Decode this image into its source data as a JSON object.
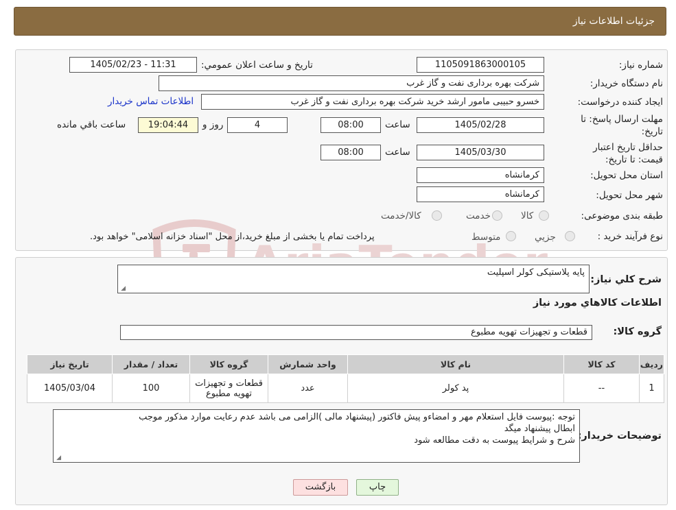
{
  "header": {
    "title": "جزئیات اطلاعات نیاز"
  },
  "colors": {
    "header_bg": "#8a6c41",
    "link": "#1a33c9",
    "panel_bg": "#f7f7f7",
    "watermark": "#e8cccc",
    "yellow_box": "#fdfbd5"
  },
  "watermark": {
    "text": "AriaTender.neT"
  },
  "form": {
    "need_number_label": "شماره نیاز:",
    "need_number": "1105091863000105",
    "announce_label": "تاریخ و ساعت اعلان عمومي:",
    "announce_value": "1405/02/23 - 11:31",
    "buyer_label": "نام دستگاه خريدار:",
    "buyer_value": "شرکت بهره برداری نفت و گاز غرب",
    "creator_label": "ايجاد کننده درخواست:",
    "creator_value": "خسرو حبیبی مامور ارشد خرید شرکت بهره برداری نفت و گاز غرب",
    "contact_link": "اطلاعات تماس خريدار",
    "deadline_label": "مهلت ارسال پاسخ: تا تاریخ:",
    "deadline_date": "1405/02/28",
    "time_label": "ساعت",
    "deadline_time": "08:00",
    "days_value": "4",
    "days_label": "روز و",
    "remaining_time": "19:04:44",
    "remaining_label": "ساعت باقي مانده",
    "validity_label": "حداقل تاريخ اعتبار قيمت: تا تاریخ:",
    "validity_date": "1405/03/30",
    "validity_time": "08:00",
    "province_label": "استان محل تحویل:",
    "province_value": "کرمانشاه",
    "city_label": "شهر محل تحویل:",
    "city_value": "کرمانشاه",
    "category_label": "طبقه بندی موضوعی:",
    "category_options": [
      "کالا",
      "خدمت",
      "کالا/خدمت"
    ],
    "process_label": "نوع فرآيند خريد :",
    "process_options": [
      "جزيي",
      "متوسط"
    ],
    "process_note": "پرداخت تمام یا بخشی از مبلغ خرید،از محل \"اسناد خزانه اسلامی\" خواهد بود."
  },
  "details": {
    "summary_label": "شرح كلي نياز:",
    "summary_value": "پایه پلاستیکی کولر اسپلیت",
    "items_heading": "اطلاعات كالاهاي مورد نياز",
    "group_label": "گروه كالا:",
    "group_value": "قطعات و تجهیزات تهویه مطبوع",
    "table": {
      "headers": [
        "رديف",
        "كد كالا",
        "نام كالا",
        "واحد شمارش",
        "گروه كالا",
        "تعداد / مقدار",
        "تاريخ نياز"
      ],
      "rows": [
        {
          "row": "1",
          "code": "--",
          "name": "پد کولر",
          "unit": "عدد",
          "group": "قطعات و تجهیزات تهویه مطبوع",
          "qty": "100",
          "date": "1405/03/04"
        }
      ]
    },
    "buyer_notes_label": "توضيحات خريدار:",
    "buyer_notes_lines": [
      "توجه :پیوست فایل استعلام مهر و امضاءو پیش فاکتور (پیشنهاد مالی )الزامی می باشد عدم رعایت موارد مذکور موجب",
      "ابطال پیشنهاد میگد",
      "شرح و شرایط پیوست به دقت مطالعه شود"
    ]
  },
  "buttons": {
    "print": "چاپ",
    "back": "بازگشت"
  }
}
